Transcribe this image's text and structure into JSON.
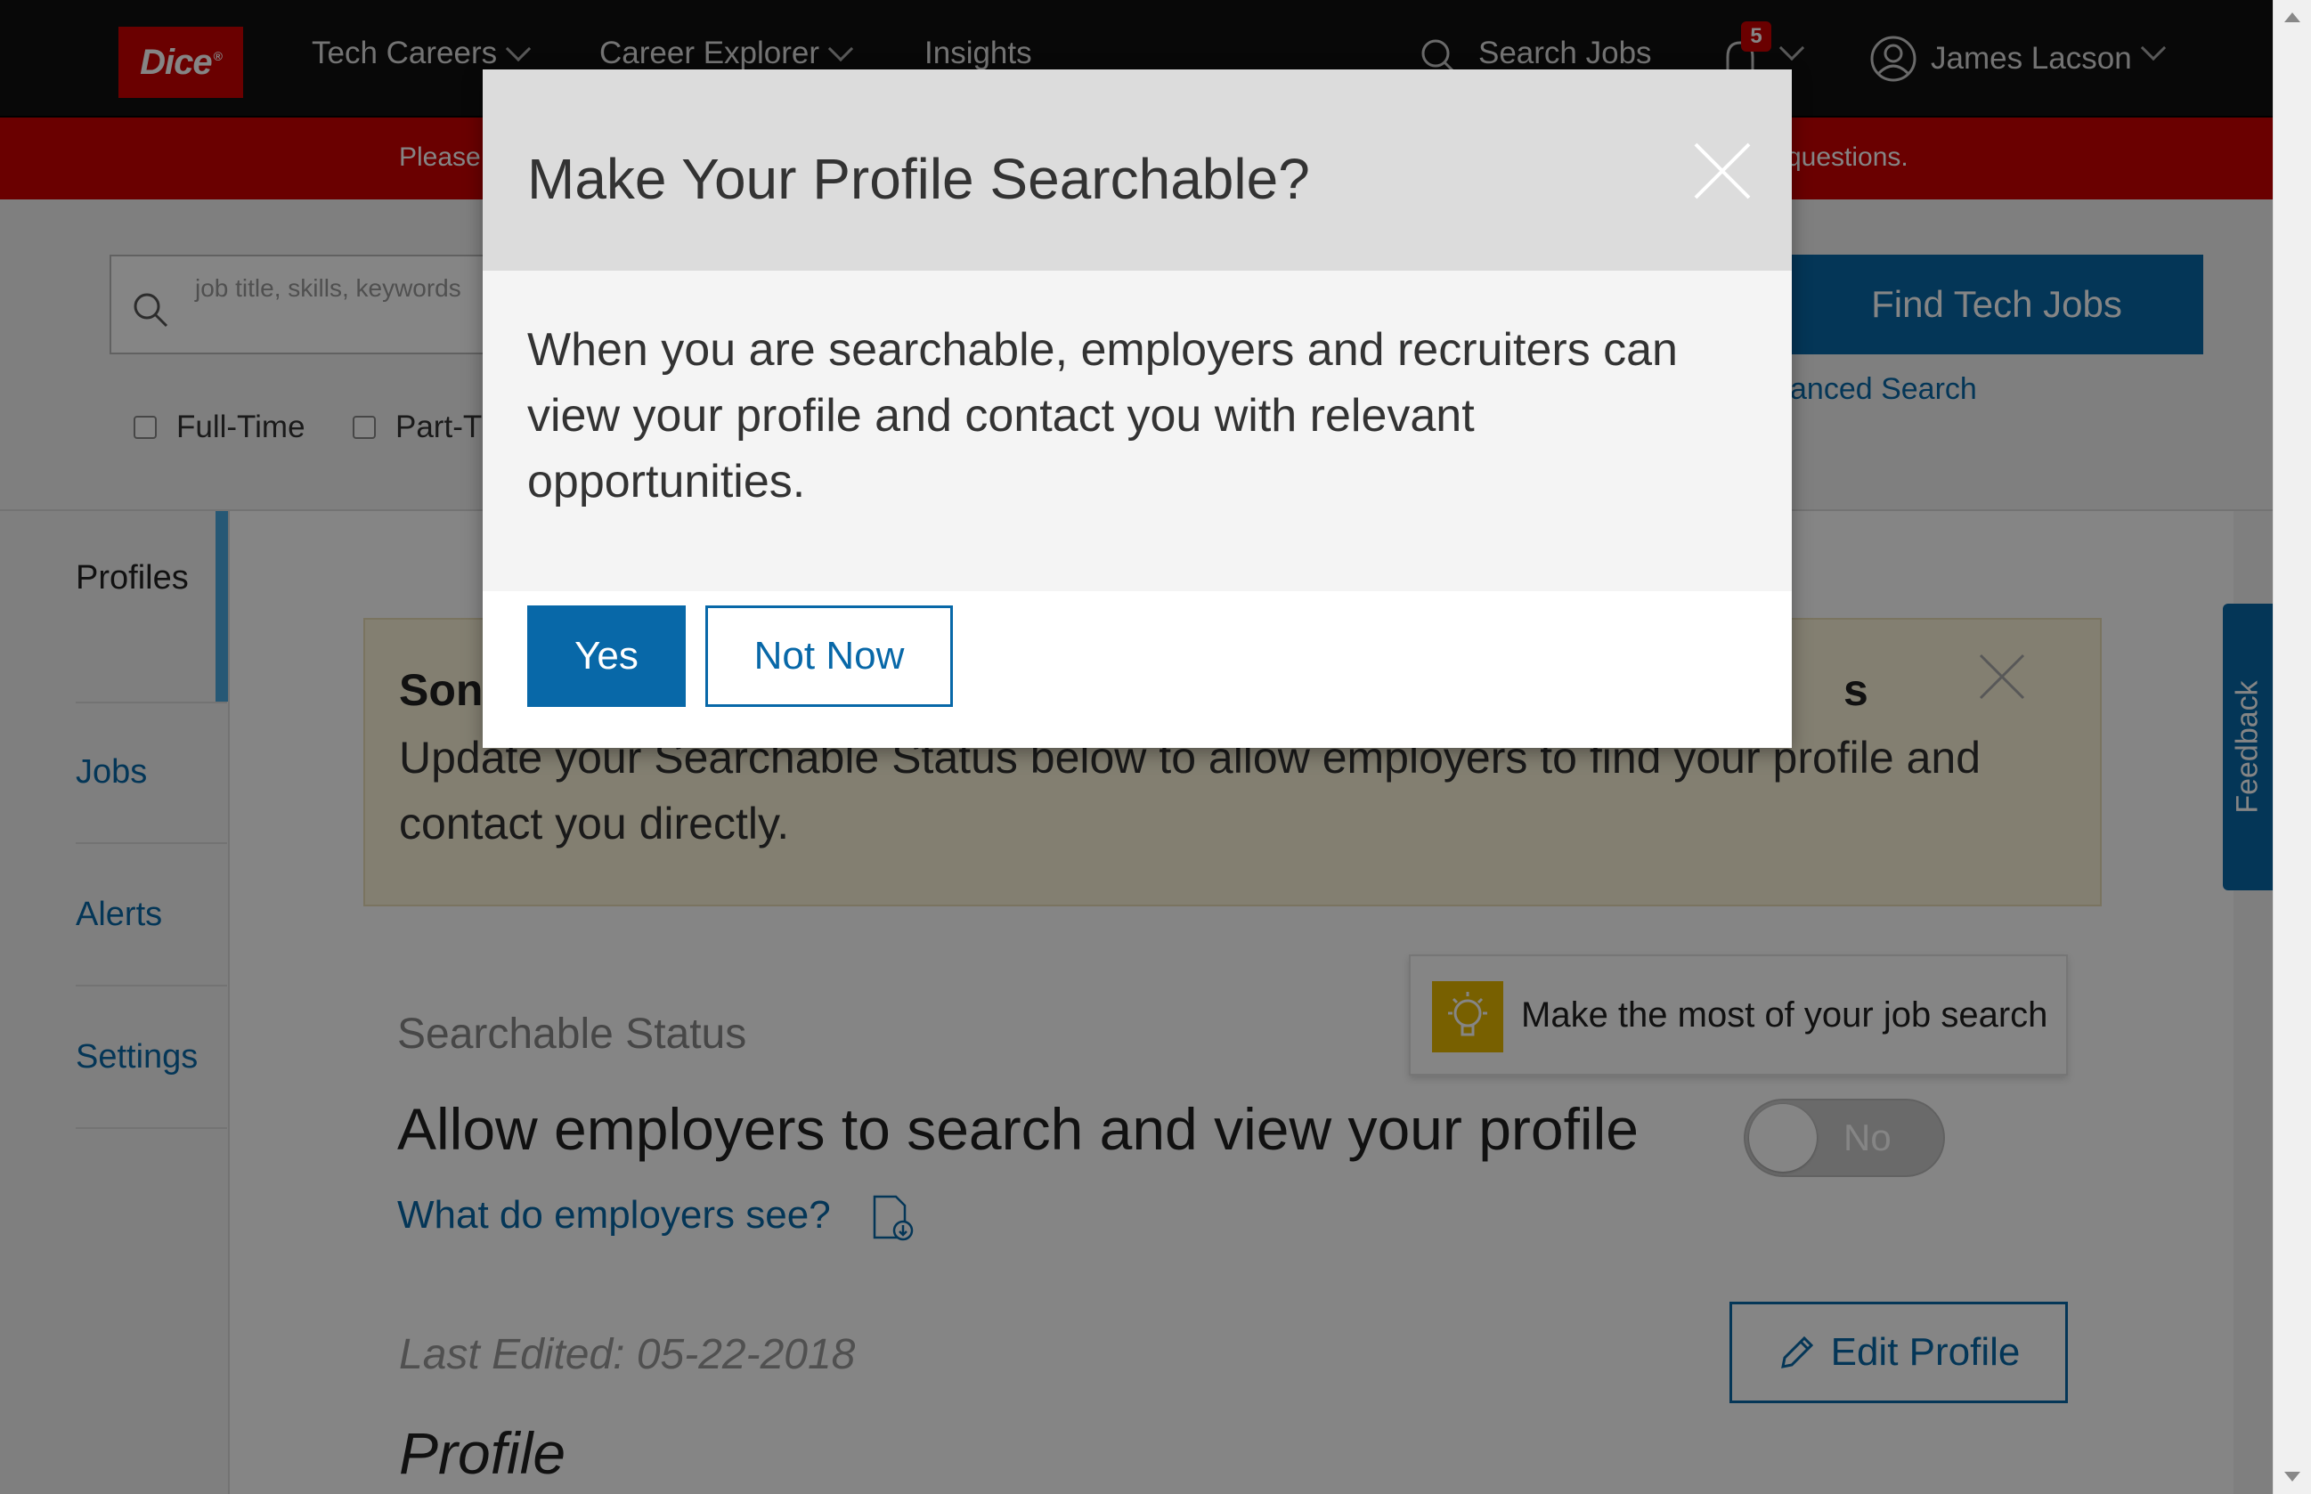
{
  "nav": {
    "logo_text": "Dice",
    "logo_mark": "®",
    "tech_careers": "Tech Careers",
    "career_explorer": "Career Explorer",
    "insights": "Insights",
    "search_jobs": "Search Jobs",
    "notification_count": "5",
    "user_name": "James Lacson"
  },
  "banner": {
    "text_left": "Please",
    "text_right": "questions."
  },
  "search": {
    "placeholder": "job title, skills, keywords",
    "find_button": "Find Tech Jobs",
    "advanced_search": "anced Search",
    "filters": [
      "Full-Time",
      "Part-T"
    ]
  },
  "sidebar": {
    "items": [
      {
        "label": "Profiles",
        "active": true
      },
      {
        "label": "Jobs"
      },
      {
        "label": "Alerts"
      },
      {
        "label": "Settings"
      }
    ]
  },
  "main": {
    "alert_title_start": "Son",
    "alert_title_end": "s",
    "alert_body": "Update your Searchable Status below to allow employers to find your profile and contact you directly.",
    "tip_text": "Make the most of your job search",
    "searchable_status_label": "Searchable Status",
    "allow_text": "Allow employers to search and view your profile",
    "toggle_value": "No",
    "employers_see_link": "What do employers see?",
    "last_edited": "Last Edited: 05-22-2018",
    "edit_profile_button": "Edit Profile",
    "profile_heading": "Profile"
  },
  "feedback": {
    "label": "Feedback"
  },
  "modal": {
    "title": "Make Your Profile Searchable?",
    "body": "When you are searchable, employers and recruiters can view your profile and contact you with relevant opportunities.",
    "yes_button": "Yes",
    "not_now_button": "Not Now"
  },
  "colors": {
    "brand_red": "#cc0000",
    "primary_blue": "#0868a8",
    "active_bar": "#4aa9e0",
    "alert_bg": "#fcf4d9",
    "tip_icon": "#e6b800"
  }
}
